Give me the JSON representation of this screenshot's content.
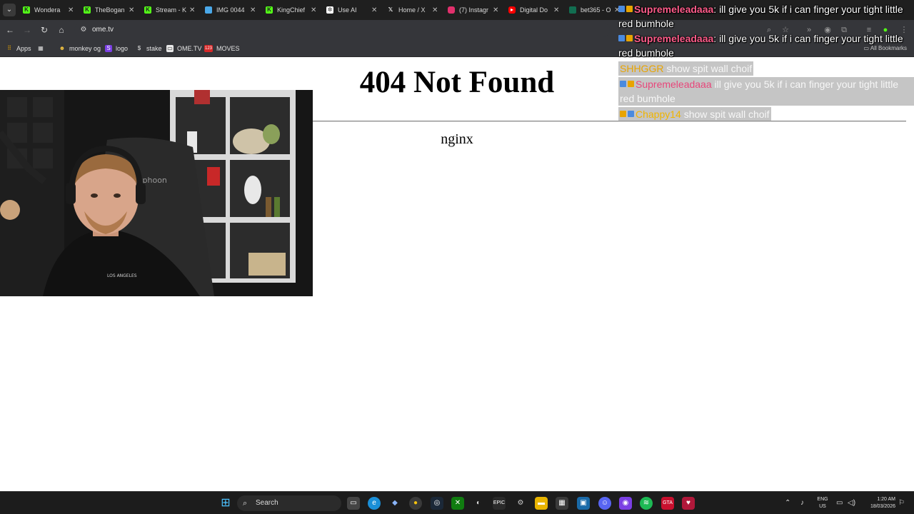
{
  "browser": {
    "tabs": [
      {
        "label": "Wondera",
        "favicon": "kick-icon",
        "color": "#53fc18"
      },
      {
        "label": "TheBogan",
        "favicon": "kick-icon",
        "color": "#53fc18"
      },
      {
        "label": "Stream - K",
        "favicon": "kick-icon",
        "color": "#53fc18"
      },
      {
        "label": "IMG 0044",
        "favicon": "image-icon",
        "color": "#4aa8e8"
      },
      {
        "label": "KingChief",
        "favicon": "kick-icon",
        "color": "#53fc18"
      },
      {
        "label": "Use AI",
        "favicon": "ai-icon",
        "color": "#ffffff"
      },
      {
        "label": "Home / X",
        "favicon": "x-icon",
        "color": "#ffffff"
      },
      {
        "label": "(7) Instagr",
        "favicon": "instagram-icon",
        "color": "#e1306c"
      },
      {
        "label": "Digital Do",
        "favicon": "youtube-icon",
        "color": "#ff0000"
      },
      {
        "label": "bet365 - O",
        "favicon": "bet365-icon",
        "color": "#126e51"
      }
    ],
    "url": "ome.tv",
    "bookmarks": [
      {
        "label": "Apps",
        "icon": "apps-grid-icon"
      },
      {
        "label": "",
        "icon": "grid-icon"
      },
      {
        "label": "monkey og",
        "icon": "monkey-icon"
      },
      {
        "label": "logo",
        "icon": "s-logo-icon"
      },
      {
        "label": "stake",
        "icon": "stake-icon"
      },
      {
        "label": "OME.TV",
        "icon": "ometv-icon"
      },
      {
        "label": "MOVES",
        "icon": "123-icon"
      }
    ],
    "all_bookmarks_label": "All Bookmarks"
  },
  "page": {
    "title": "404 Not Found",
    "server": "nginx"
  },
  "chat": [
    {
      "user": "Supremeleadaaa",
      "text": ": ill give you 5k if i can finger your tight little red bumhole",
      "user_color": "#ff5c8a",
      "style": "normal"
    },
    {
      "user": "Supremeleadaaa",
      "text": ": ill give you 5k if i can finger your tight little red bumhole",
      "user_color": "#ff5c8a",
      "style": "normal"
    },
    {
      "user": "SHHGGR",
      "text": " show spit wall choif",
      "user_color": "#e8a400",
      "style": "faded"
    },
    {
      "user": "Supremeleadaaa",
      "text": " ill give you 5k if i can finger your tight little red bumhole",
      "user_color": "#e8467a",
      "style": "faded"
    },
    {
      "user": "Chappy14",
      "text": " show spit wall choif",
      "user_color": "#f0b400",
      "style": "faded"
    }
  ],
  "taskbar": {
    "search_label": "Search",
    "lang_line1": "ENG",
    "lang_line2": "US",
    "time": "1:20 AM",
    "date": "18/03/2026"
  },
  "colors": {
    "tab_strip": "#1f1f1f",
    "toolbar": "#35363a",
    "kick_green": "#53fc18",
    "taskbar": "#1c1c1c"
  }
}
